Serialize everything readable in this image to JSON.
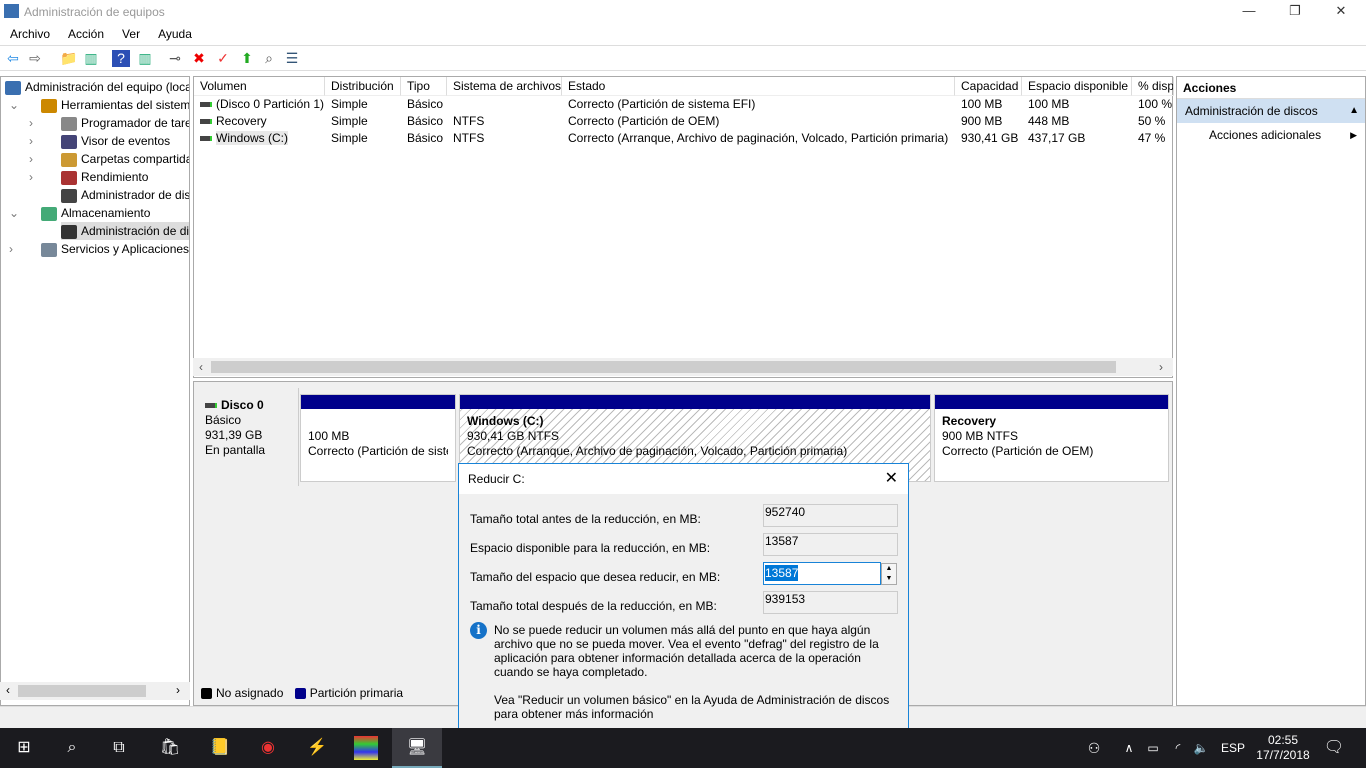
{
  "window": {
    "title": "Administración de equipos",
    "minimize": "—",
    "restore": "❐",
    "close": "✕"
  },
  "menu": [
    "Archivo",
    "Acción",
    "Ver",
    "Ayuda"
  ],
  "toolbar": [
    {
      "icon": "back-icon",
      "g": "⇦",
      "c": "#1e88e5"
    },
    {
      "icon": "forward-icon",
      "g": "⇨",
      "c": "#666"
    },
    {
      "icon": "up-folder-icon",
      "g": "📁",
      "c": "#c9a227"
    },
    {
      "icon": "show-hide-tree-icon",
      "g": "▥",
      "c": "#2a7"
    },
    {
      "icon": "help-icon",
      "g": "?",
      "c": "#fff"
    },
    {
      "icon": "show-hide-action-pane-icon",
      "g": "▥",
      "c": "#2a7"
    },
    {
      "icon": "connect-drive-icon",
      "g": "⊸",
      "c": "#555"
    },
    {
      "icon": "delete-icon",
      "g": "✖",
      "c": "#e00"
    },
    {
      "icon": "properties-icon",
      "g": "✓",
      "c": "#e33"
    },
    {
      "icon": "export-icon",
      "g": "⬆",
      "c": "#2a2"
    },
    {
      "icon": "search-icon",
      "g": "⌕",
      "c": "#555"
    },
    {
      "icon": "settings-list-icon",
      "g": "☰",
      "c": "#357"
    }
  ],
  "tree": [
    {
      "label": "Administración del equipo (local)",
      "level": 0,
      "icon": "computer-icon",
      "exp": ""
    },
    {
      "label": "Herramientas del sistema",
      "level": 1,
      "icon": "tools-icon",
      "exp": "⌄"
    },
    {
      "label": "Programador de tareas",
      "level": 2,
      "icon": "clock-icon",
      "exp": "›"
    },
    {
      "label": "Visor de eventos",
      "level": 2,
      "icon": "event-viewer-icon",
      "exp": "›"
    },
    {
      "label": "Carpetas compartidas",
      "level": 2,
      "icon": "shared-folder-icon",
      "exp": "›"
    },
    {
      "label": "Rendimiento",
      "level": 2,
      "icon": "performance-icon",
      "exp": "›"
    },
    {
      "label": "Administrador de dispositivos",
      "level": 2,
      "icon": "device-manager-icon",
      "exp": ""
    },
    {
      "label": "Almacenamiento",
      "level": 1,
      "icon": "storage-icon",
      "exp": "⌄"
    },
    {
      "label": "Administración de discos",
      "level": 2,
      "icon": "disk-management-icon",
      "exp": "",
      "selected": true
    },
    {
      "label": "Servicios y Aplicaciones",
      "level": 1,
      "icon": "services-icon",
      "exp": "›"
    }
  ],
  "columns": [
    "Volumen",
    "Distribución",
    "Tipo",
    "Sistema de archivos",
    "Estado",
    "Capacidad",
    "Espacio disponible",
    "% disponible"
  ],
  "volumes": [
    [
      "(Disco 0 Partición 1)",
      "Simple",
      "Básico",
      "",
      "Correcto (Partición de sistema EFI)",
      "100 MB",
      "100 MB",
      "100 %"
    ],
    [
      "Recovery",
      "Simple",
      "Básico",
      "NTFS",
      "Correcto (Partición de OEM)",
      "900 MB",
      "448 MB",
      "50 %"
    ],
    [
      "Windows (C:)",
      "Simple",
      "Básico",
      "NTFS",
      "Correcto (Arranque, Archivo de paginación, Volcado, Partición primaria)",
      "930,41 GB",
      "437,17 GB",
      "47 %"
    ]
  ],
  "disk": {
    "name": "Disco 0",
    "type": "Básico",
    "size": "931,39 GB",
    "status": "En pantalla",
    "partitions": [
      {
        "name": "",
        "size": "100 MB",
        "status": "Correcto (Partición de sistema EFI)"
      },
      {
        "name": "Windows  (C:)",
        "size": "930,41 GB NTFS",
        "status": "Correcto (Arranque, Archivo de paginación, Volcado, Partición primaria)"
      },
      {
        "name": "Recovery",
        "size": "900 MB NTFS",
        "status": "Correcto (Partición de OEM)"
      }
    ]
  },
  "legend": [
    {
      "label": "No asignado",
      "color": "#000000"
    },
    {
      "label": "Partición primaria",
      "color": "#00008b"
    }
  ],
  "actions": {
    "header": "Acciones",
    "section": "Administración de discos",
    "item": "Acciones adicionales"
  },
  "dialog": {
    "title": "Reducir C:",
    "rows": [
      {
        "label": "Tamaño total antes de la reducción, en MB:",
        "value": "952740"
      },
      {
        "label": "Espacio disponible para la reducción, en MB:",
        "value": "13587"
      },
      {
        "label": "Tamaño del espacio que desea reducir, en MB:",
        "value": "13587"
      },
      {
        "label": "Tamaño total después de la reducción, en MB:",
        "value": "939153"
      }
    ],
    "info": "No se puede reducir un volumen más allá del punto en que haya algún archivo que no se pueda mover. Vea el evento \"defrag\" del registro de la aplicación para obtener información detallada acerca de la operación cuando se haya completado.",
    "help": "Vea \"Reducir un volumen básico\"  en la Ayuda de Administración de discos para obtener más información"
  },
  "taskbar": {
    "lang": "ESP",
    "time": "02:55",
    "date": "17/7/2018"
  }
}
